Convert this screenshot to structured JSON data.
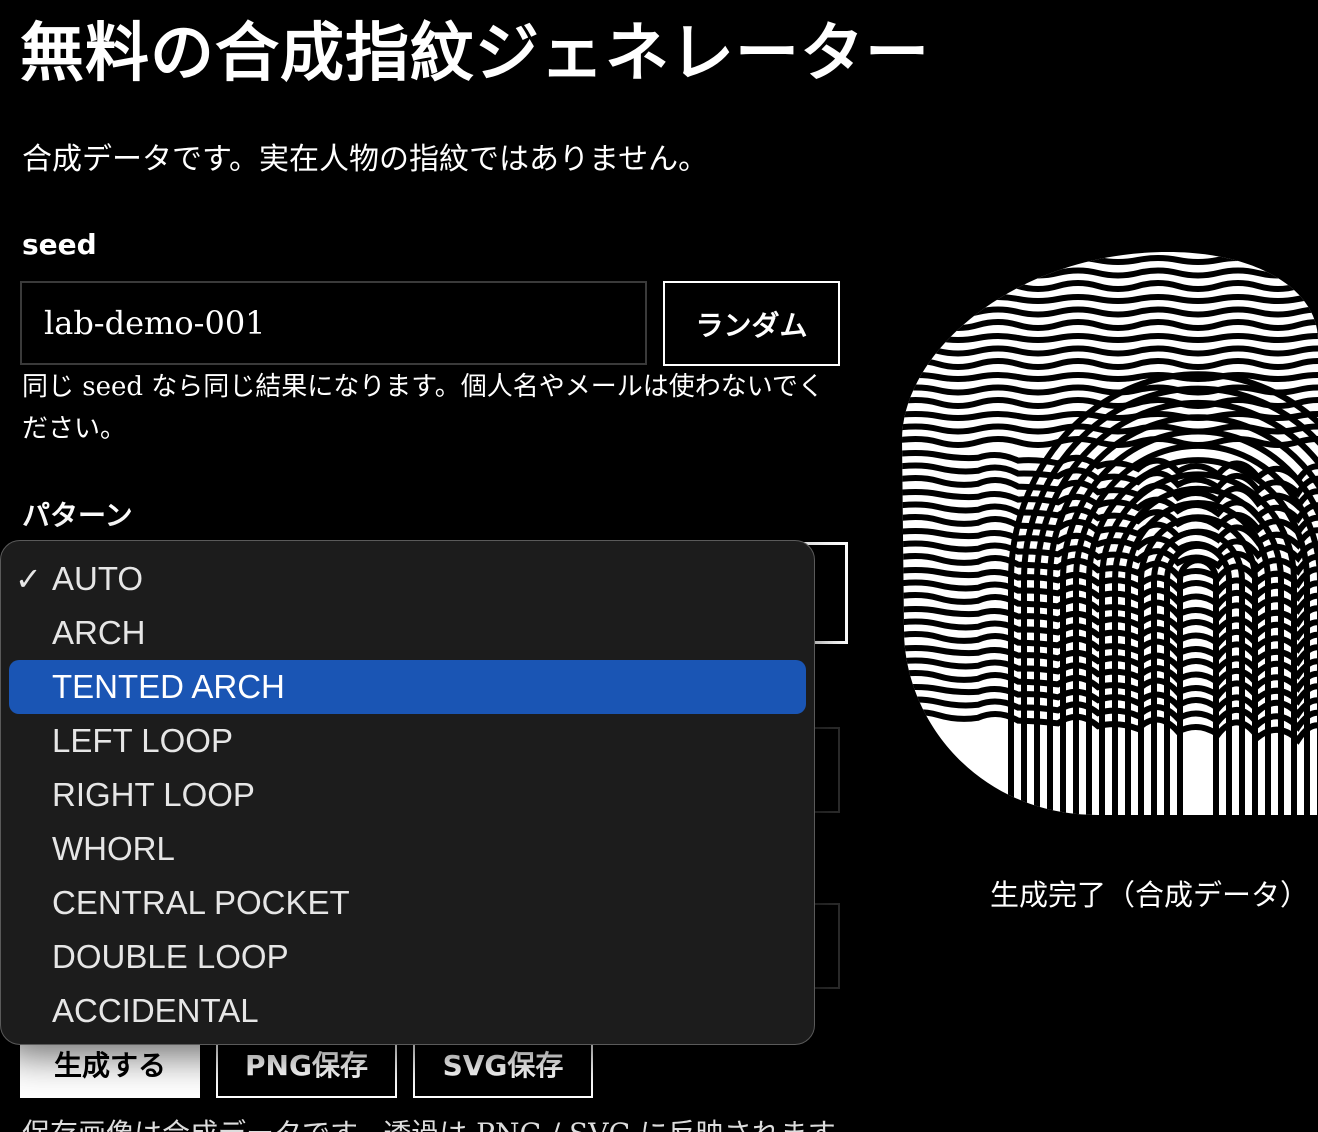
{
  "title": "無料の合成指紋ジェネレーター",
  "subtitle": "合成データです。実在人物の指紋ではありません。",
  "seed": {
    "label": "seed",
    "value": "lab-demo-001",
    "random_button": "ランダム",
    "hint": "同じ seed なら同じ結果になります。個人名やメールは使わないでください。"
  },
  "pattern": {
    "label": "パターン",
    "checked_value": "AUTO",
    "highlighted_value": "TENTED ARCH",
    "options": [
      "AUTO",
      "ARCH",
      "TENTED ARCH",
      "LEFT LOOP",
      "RIGHT LOOP",
      "WHORL",
      "CENTRAL POCKET",
      "DOUBLE LOOP",
      "ACCIDENTAL"
    ]
  },
  "actions": {
    "generate": "生成する",
    "save_png": "PNG保存",
    "save_svg": "SVG保存"
  },
  "footnote": "保存画像は合成データです。透過は PNG / SVG に反映されます。",
  "preview": {
    "status": "生成完了（合成データ）"
  },
  "colors": {
    "background": "#000000",
    "highlight": "#1a55b4",
    "menu_bg": "#1c1c1c"
  }
}
